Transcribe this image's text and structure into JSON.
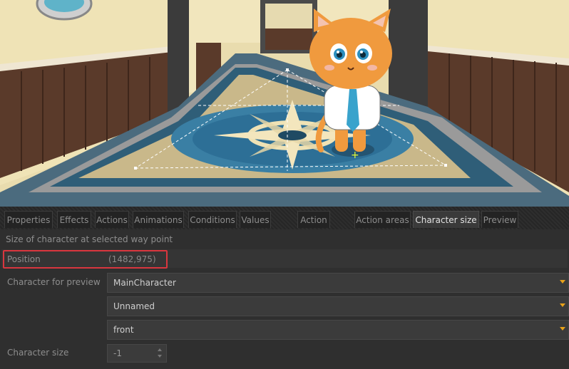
{
  "tabs": [
    {
      "label": "Properties",
      "active": false
    },
    {
      "label": "Effects",
      "active": false
    },
    {
      "label": "Actions",
      "active": false
    },
    {
      "label": "Animations",
      "active": false
    },
    {
      "label": "Conditions",
      "active": false
    },
    {
      "label": "Values",
      "active": false
    },
    {
      "label": "Action",
      "active": false
    },
    {
      "label": "Action areas",
      "active": false
    },
    {
      "label": "Character size",
      "active": true
    },
    {
      "label": "Preview",
      "active": false
    }
  ],
  "panel": {
    "description": "Size of character at selected way point",
    "position_label": "Position",
    "position_value": "(1482,975)",
    "character_preview_label": "Character for preview",
    "character_preview_value": "MainCharacter",
    "outfit_value": "Unnamed",
    "direction_value": "front",
    "character_size_label": "Character size",
    "character_size_value": "-1"
  },
  "colors": {
    "accent": "#e8a21a",
    "highlight_border": "#d9363e",
    "panel_bg": "#2f2f2f"
  }
}
